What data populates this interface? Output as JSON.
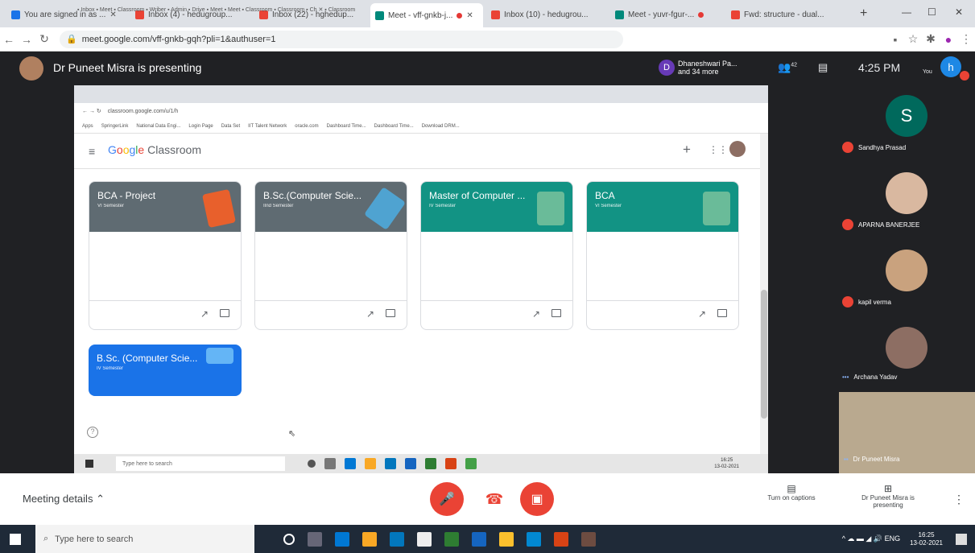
{
  "browser": {
    "tabs": [
      {
        "label": "You are signed in as ..."
      },
      {
        "label": "Inbox (4) - hedugroup..."
      },
      {
        "label": "Inbox (22) - hghedup..."
      },
      {
        "label": "Meet - vff-gnkb-j...",
        "active": true
      },
      {
        "label": "Inbox (10) - hedugrou..."
      },
      {
        "label": "Meet - yuvr-fgur-..."
      },
      {
        "label": "Fwd: structure - dual..."
      }
    ],
    "new_tab": "+",
    "url": "meet.google.com/vff-gnkb-gqh?pli=1&authuser=1"
  },
  "meet": {
    "presenting_text": "Dr Puneet Misra is presenting",
    "presenter_chip": {
      "initial": "D",
      "line1": "Dhaneshwari Pa...",
      "line2": "and 34 more"
    },
    "participant_count": "42",
    "time": "4:25 PM",
    "self_label": "You",
    "self_initial": "h",
    "meeting_details": "Meeting details",
    "captions_label": "Turn on captions",
    "presenting_info": "Dr Puneet Misra is presenting"
  },
  "participants": [
    {
      "name": "Sandhya Prasad",
      "initial": "S",
      "color": "#00695c"
    },
    {
      "name": "APARNA BANERJEE",
      "color": "#d9b8a0"
    },
    {
      "name": "kapil verma",
      "color": "#c9a27e"
    },
    {
      "name": "Archana Yadav",
      "color": "#8d6e63"
    },
    {
      "name": "Dr Puneet Misra"
    }
  ],
  "classroom": {
    "app_name": "Classroom",
    "inner_url": "classroom.google.com/u/1/h",
    "bookmarks": [
      "Apps",
      "SpringerLink",
      "National Data Engi...",
      "Login Page",
      "Data Set",
      "IIT Talent Network",
      "oracle.com",
      "Dashboard Time...",
      "Dashboard Time...",
      "Download DRM..."
    ],
    "cards": [
      {
        "title": "BCA - Project",
        "sub": "VI Semester",
        "color": "#5f6b72",
        "art": "#e8602c"
      },
      {
        "title": "B.Sc.(Computer Scie...",
        "sub": "IInd Semester",
        "color": "#5f6b72",
        "art": "#4fa3d1"
      },
      {
        "title": "Master of Computer ...",
        "sub": "IV Semester",
        "color": "#129384",
        "art": "#a5d6a7"
      },
      {
        "title": "BCA",
        "sub": "VI Semester",
        "color": "#129384",
        "art": "#a5d6a7"
      },
      {
        "title": "B.Sc. (Computer Scie...",
        "sub": "IV Semester",
        "color": "#1a73e8",
        "art": "#64b5f6"
      }
    ],
    "inner_search": "Type here to search",
    "inner_clock_time": "16:25",
    "inner_clock_date": "13-02-2021"
  },
  "taskbar": {
    "search_placeholder": "Type here to search",
    "clock_time": "16:25",
    "clock_date": "13-02-2021",
    "lang": "ENG"
  }
}
